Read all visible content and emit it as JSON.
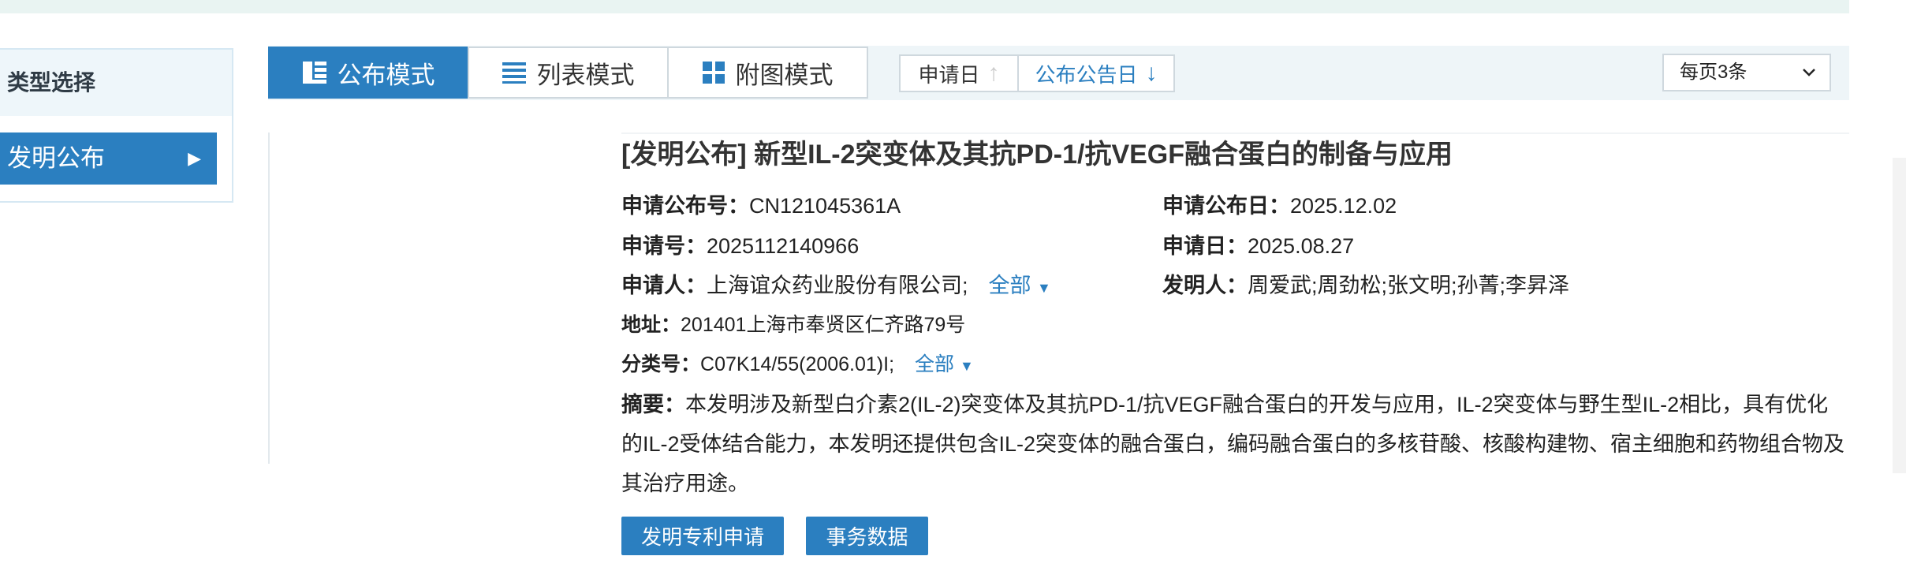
{
  "left_panel": {
    "header": "类型选择",
    "items": [
      {
        "label": "发明公布"
      }
    ]
  },
  "toolbar": {
    "modes": [
      {
        "label": "公布模式",
        "icon": "publish-mode-icon",
        "active": true
      },
      {
        "label": "列表模式",
        "icon": "list-icon",
        "active": false
      },
      {
        "label": "附图模式",
        "icon": "grid-icon",
        "active": false
      }
    ],
    "sort": [
      {
        "label": "申请日",
        "arrow": "↑",
        "arrow_icon": "arrow-up-icon",
        "arrow_color": "#cccccc"
      },
      {
        "label": "公布公告日",
        "arrow": "↓",
        "arrow_icon": "arrow-down-icon",
        "arrow_color": "#2b7fc0"
      }
    ],
    "per_page": "每页3条"
  },
  "result": {
    "title": "[发明公布] 新型IL-2突变体及其抗PD-1/抗VEGF融合蛋白的制备与应用",
    "pub_no_label": "申请公布号：",
    "pub_no": "CN121045361A",
    "pub_date_label": "申请公布日：",
    "pub_date": "2025.12.02",
    "app_no_label": "申请号：",
    "app_no": "2025112140966",
    "app_date_label": "申请日：",
    "app_date": "2025.08.27",
    "applicant_label": "申请人：",
    "applicant": "上海谊众药业股份有限公司;",
    "more_label": "全部",
    "inventor_label": "发明人：",
    "inventor": "周爱武;周劲松;张文明;孙菁;李昇泽",
    "address_label": "地址：",
    "address": "201401上海市奉贤区仁齐路79号",
    "class_label": "分类号：",
    "class_no": "C07K14/55(2006.01)I;",
    "abstract_label": "摘要：",
    "abstract": "本发明涉及新型白介素2(IL-2)突变体及其抗PD-1/抗VEGF融合蛋白的开发与应用，IL-2突变体与野生型IL-2相比，具有优化的IL-2受体结合能力，本发明还提供包含IL-2突变体的融合蛋白，编码融合蛋白的多核苷酸、核酸构建物、宿主细胞和药物组合物及其治疗用途。",
    "buttons": [
      "发明专利申请",
      "事务数据"
    ]
  },
  "colors": {
    "accent": "#2b7fc0",
    "panel_bg": "#eef5f8"
  }
}
